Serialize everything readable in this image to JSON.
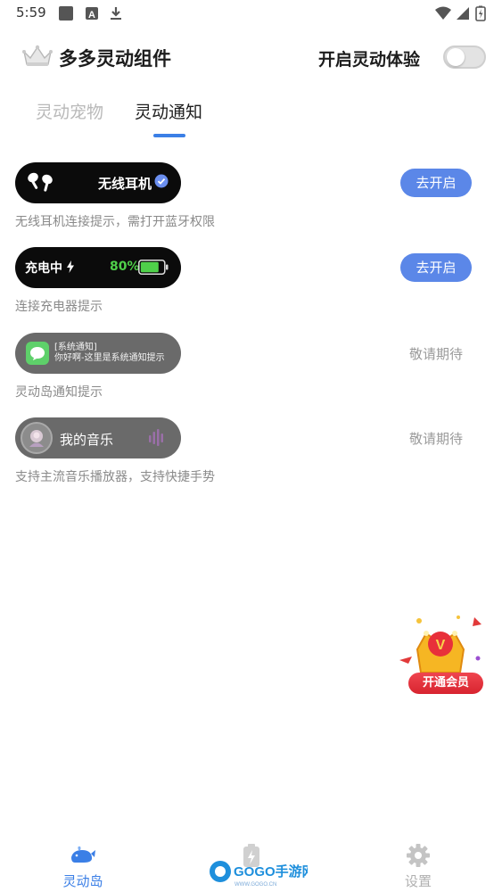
{
  "status_bar": {
    "time": "5:59",
    "left_icons": [
      "square-notification-icon",
      "font-a-icon",
      "download-icon"
    ],
    "right_icons": [
      "wifi-icon",
      "signal-icon",
      "battery-charging-icon"
    ]
  },
  "header": {
    "title": "多多灵动组件",
    "toggle_label": "开启灵动体验",
    "toggle_on": false,
    "logo_icon": "crown-icon"
  },
  "tabs": [
    {
      "label": "灵动宠物",
      "active": false
    },
    {
      "label": "灵动通知",
      "active": true
    }
  ],
  "items": [
    {
      "pill_text": "无线耳机",
      "pill_icons": [
        "earbuds-icon",
        "verified-check-icon"
      ],
      "description": "无线耳机连接提示，需打开蓝牙权限",
      "action": "去开启",
      "action_type": "button"
    },
    {
      "pill_text": "充电中",
      "pill_value": "80%",
      "pill_icons": [
        "lightning-icon",
        "battery-icon"
      ],
      "battery_level": 0.8,
      "description": "连接充电器提示",
      "action": "去开启",
      "action_type": "button"
    },
    {
      "pill_line1": "[系统通知]",
      "pill_line2": "你好啊-这里是系统通知提示",
      "pill_icons": [
        "message-bubble-icon"
      ],
      "description": "灵动岛通知提示",
      "action": "敬请期待",
      "action_type": "text"
    },
    {
      "pill_text": "我的音乐",
      "pill_icons": [
        "album-avatar-icon",
        "audio-wave-icon"
      ],
      "description": "支持主流音乐播放器，支持快捷手势",
      "action": "敬请期待",
      "action_type": "text"
    }
  ],
  "vip": {
    "label": "开通会员",
    "icon": "vip-crown-icon"
  },
  "bottom_nav": [
    {
      "label": "灵动岛",
      "icon": "whale-icon",
      "active": true
    },
    {
      "label": "",
      "icon": "battery-bolt-icon",
      "active": false
    },
    {
      "label": "设置",
      "icon": "gear-icon",
      "active": false
    }
  ],
  "watermark": {
    "main": "GOGO手游网",
    "sub": "WWW.GOGO.CN"
  },
  "colors": {
    "accent": "#3b7fe6",
    "button": "#5b87e8",
    "pill_dark": "#0b0b0b",
    "pill_grey": "#6a6a6a",
    "battery_green": "#4fd04a",
    "vip_red": "#e0313b"
  }
}
